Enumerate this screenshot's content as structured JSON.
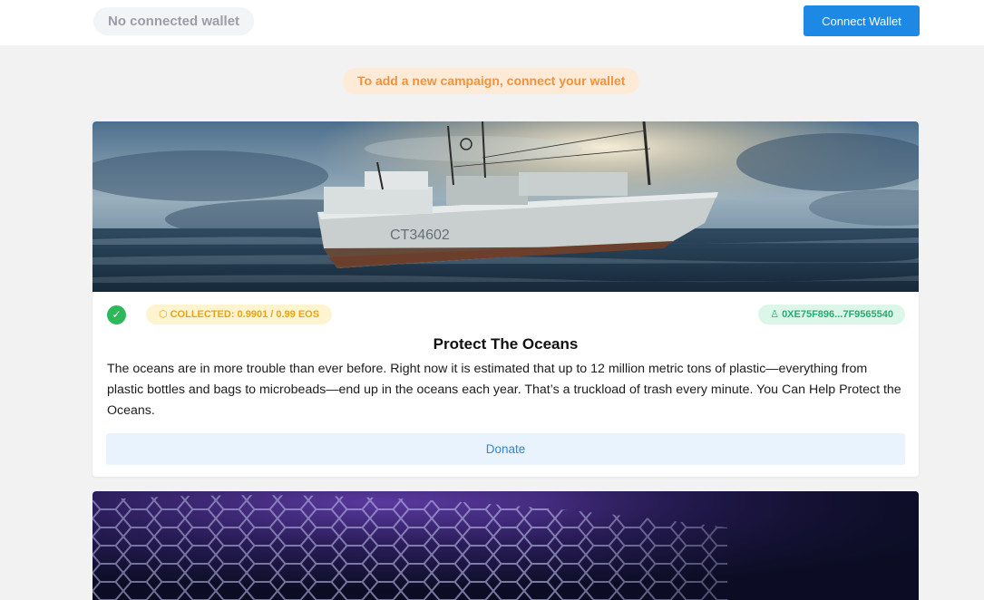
{
  "header": {
    "wallet_status": "No connected wallet",
    "connect_label": "Connect Wallet"
  },
  "notice": {
    "text": "To add a new campaign, connect your wallet"
  },
  "campaigns": [
    {
      "image": "ship-at-sea-photo",
      "status_icon": "check-icon",
      "collected_text": "COLLECTED: 0.9901 / 0.99 EOS",
      "collected_progress_fraction": 1.0,
      "owner_address": "0XE75F896...7F9565540",
      "title": "Protect The Oceans",
      "description": "The oceans are in more trouble than ever before. Right now it is estimated that up to 12 million metric tons of plastic—everything from plastic bottles and bags to microbeads—end up in the oceans each year. That’s a truckload of trash every minute. You Can Help Protect the Oceans.",
      "donate_label": "Donate"
    },
    {
      "image": "hexagon-network-photo"
    }
  ],
  "colors": {
    "accent": "#1e88e5",
    "notice_text": "#f2923b",
    "collected_text": "#e8a317",
    "address_text": "#20b070",
    "success": "#2eb85c"
  }
}
